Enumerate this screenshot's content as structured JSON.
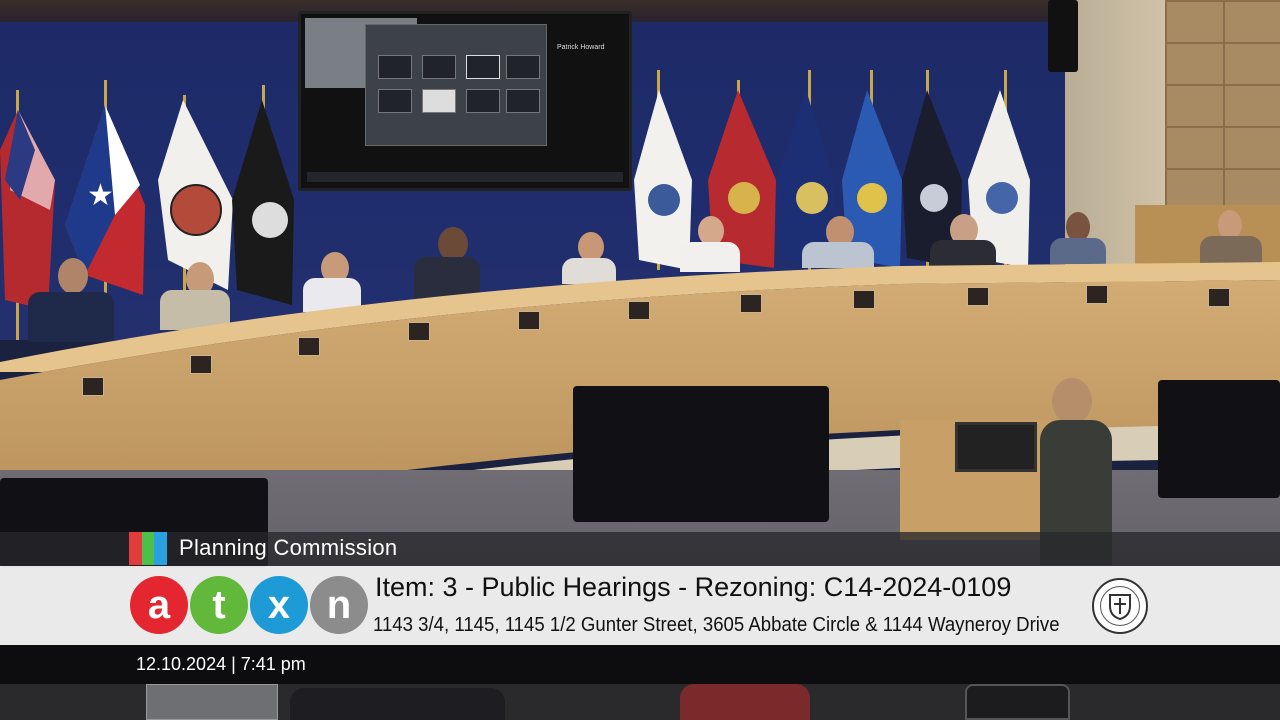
{
  "overlay": {
    "committee_name": "Planning Commission",
    "color_bars": [
      "#e23b3b",
      "#4cc04a",
      "#2aa0e0"
    ],
    "logo": {
      "letters": [
        {
          "char": "a",
          "color": "#e3262f"
        },
        {
          "char": "t",
          "color": "#62b83a"
        },
        {
          "char": "x",
          "color": "#1e9ad6"
        },
        {
          "char": "n",
          "color": "#8c8c8c"
        }
      ],
      "icon": "atxn-logo"
    },
    "item_title": "Item: 3 - Public Hearings - Rezoning: C14-2024-0109",
    "item_address": "1143 3/4, 1145, 1145 1/2 Gunter Street, 3605 Abbate Circle & 1144 Wayneroy Drive",
    "datetime": "12.10.2024 | 7:41 pm",
    "seal_icon": "city-of-austin-seal-icon"
  },
  "scene": {
    "screen_name": "Patrick Howard"
  }
}
